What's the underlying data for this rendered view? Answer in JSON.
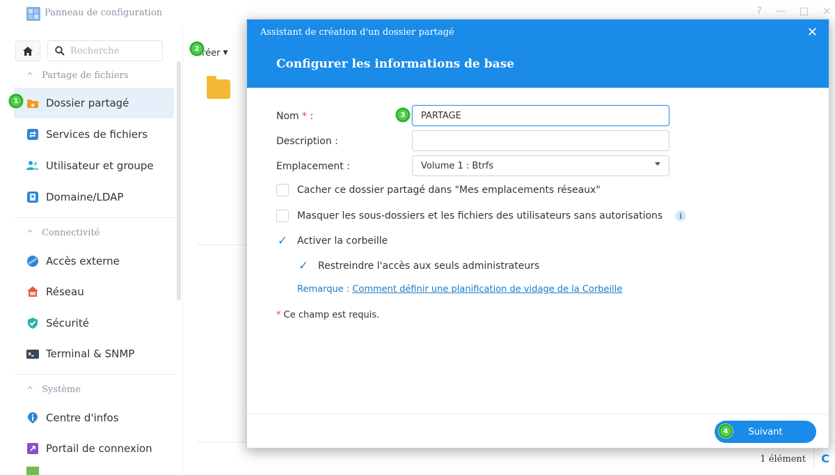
{
  "app": {
    "title": "Panneau de configuration",
    "window_controls": [
      "?",
      "—",
      "□",
      "×"
    ]
  },
  "sidebar": {
    "search_placeholder": "Recherche",
    "sections": [
      {
        "label": "Partage de fichiers",
        "items": [
          {
            "label": "Dossier partagé",
            "icon": "shared-folder-icon",
            "active": true
          },
          {
            "label": "Services de fichiers",
            "icon": "file-services-icon"
          },
          {
            "label": "Utilisateur et groupe",
            "icon": "users-icon"
          },
          {
            "label": "Domaine/LDAP",
            "icon": "domain-icon"
          }
        ]
      },
      {
        "label": "Connectivité",
        "items": [
          {
            "label": "Accès externe",
            "icon": "external-access-icon"
          },
          {
            "label": "Réseau",
            "icon": "network-icon"
          },
          {
            "label": "Sécurité",
            "icon": "security-shield-icon"
          },
          {
            "label": "Terminal & SNMP",
            "icon": "terminal-icon"
          }
        ]
      },
      {
        "label": "Système",
        "items": [
          {
            "label": "Centre d'infos",
            "icon": "info-center-icon"
          },
          {
            "label": "Portail de connexion",
            "icon": "login-portal-icon"
          }
        ]
      }
    ]
  },
  "main": {
    "create_label": "Créer",
    "status_count": "1 élément"
  },
  "steps": [
    "1",
    "2",
    "3",
    "4"
  ],
  "dialog": {
    "title": "Assistant de création d'un dossier partagé",
    "heading": "Configurer les informations de base",
    "fields": {
      "name_label": "Nom",
      "name_required": "*",
      "name_suffix": " :",
      "name_value": "PARTAGE",
      "description_label": "Description :",
      "description_value": "",
      "location_label": "Emplacement :",
      "location_value": "Volume 1 :  Btrfs"
    },
    "options": {
      "hide_network": {
        "label": "Cacher ce dossier partagé dans \"Mes emplacements réseaux\"",
        "checked": false
      },
      "hide_subfolders": {
        "label": "Masquer les sous-dossiers et les fichiers des utilisateurs sans autorisations",
        "checked": false
      },
      "recycle_bin": {
        "label": "Activer la corbeille",
        "checked": true
      },
      "restrict_admin": {
        "label": "Restreindre l'accès aux seuls administrateurs",
        "checked": true
      }
    },
    "note_prefix": "Remarque : ",
    "note_link": "Comment définir une planification de vidage de la Corbeille",
    "required_star": "*",
    "required_note": " Ce champ est requis.",
    "next_label": "Suivant"
  },
  "colors": {
    "accent": "#1a8be8",
    "active_nav_bg": "#e6f0fb",
    "required": "#e2413a",
    "step_badge": "#4bd14b"
  }
}
